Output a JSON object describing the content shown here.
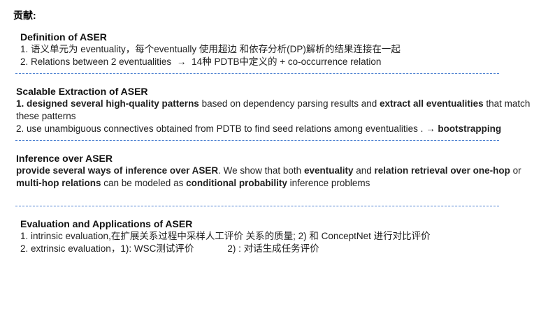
{
  "page_title": "贡献:",
  "sections": [
    {
      "heading": "Definition of ASER",
      "line1": "1. 语义单元为 eventuality，每个eventually 使用超边 和依存分析(DP)解析的结果连接在一起",
      "line2_a": "2. Relations between 2 eventualities",
      "line2_arrow": "→",
      "line2_b": "14种 PDTB中定义的 + co-occurrence relation"
    },
    {
      "heading": "Scalable Extraction of ASER",
      "p1_bold1": "1. designed several high-quality patterns",
      "p1_text1": " based on dependency parsing results and ",
      "p1_bold2": "extract all eventualities",
      "p1_text2": " that match these patterns",
      "p2_text": "2. use unambiguous connectives obtained from PDTB to find seed relations among eventualities . ",
      "p2_arrow": "→",
      "p2_bold": " bootstrapping"
    },
    {
      "heading": "Inference over ASER",
      "bold1": "provide several ways of inference over ASER",
      "text1": ". We show that both ",
      "bold2": "eventuality",
      "text2": " and ",
      "bold3": "relation retrieval over one-hop",
      "text3": " or ",
      "bold4": "multi-hop relations",
      "text4": " can be modeled as ",
      "bold5": "conditional probability",
      "text5": " inference problems"
    },
    {
      "heading": "Evaluation and Applications of ASER",
      "line1": "1. intrinsic evaluation,在扩展关系过程中采样人工评价 关系的质量;      2) 和 ConceptNet 进行对比评价",
      "line2_a": "2. extrinsic evaluation，1):  WSC测试评价",
      "line2_b": "2) : 对话生成任务评价"
    }
  ],
  "colors": {
    "divider": "#4a7fd0",
    "text": "#1f1f1f"
  }
}
